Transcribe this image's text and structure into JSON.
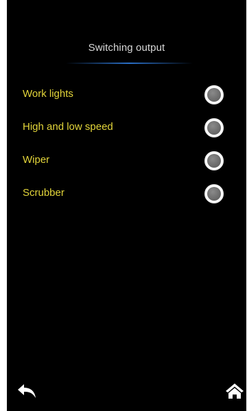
{
  "header": {
    "title": "Switching output"
  },
  "outputs": [
    {
      "label": "Work lights",
      "state": "off"
    },
    {
      "label": "High and low speed",
      "state": "off"
    },
    {
      "label": "Wiper",
      "state": "off"
    },
    {
      "label": "Scrubber",
      "state": "off"
    }
  ],
  "footer": {
    "back_icon": "back-arrow-icon",
    "home_icon": "home-icon"
  },
  "colors": {
    "background": "#000000",
    "title_text": "#d8d8d8",
    "label_text": "#e3d53a",
    "accent_line": "#2a6fc8",
    "toggle_fill": "#6e6e6e",
    "toggle_ring": "#ffffff"
  }
}
